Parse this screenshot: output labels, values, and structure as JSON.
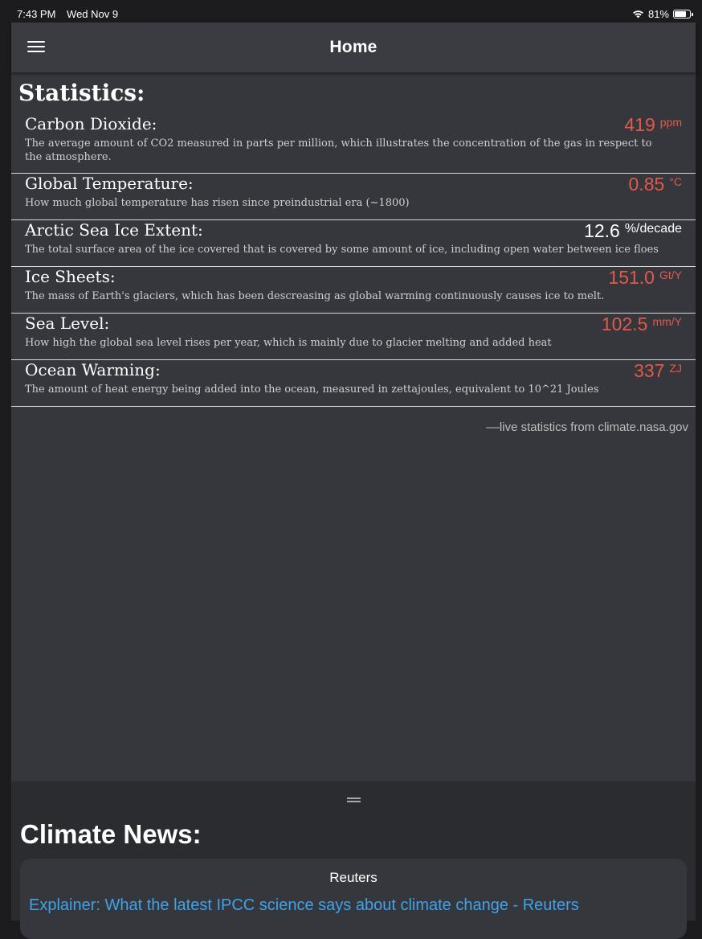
{
  "status_bar": {
    "time": "7:43 PM",
    "date": "Wed Nov 9",
    "battery": "81%",
    "battery_level": 0.81
  },
  "navbar": {
    "title": "Home"
  },
  "statistics": {
    "heading": "Statistics:",
    "items": [
      {
        "name": "Carbon Dioxide:",
        "description": "The average amount of CO2 measured in parts per million, which illustrates the concentration of the gas in respect to the atmosphere.",
        "value": "419",
        "unit": "ppm",
        "color": "#e15a4b"
      },
      {
        "name": "Global Temperature:",
        "description": "How much global temperature has risen since preindustrial era (~1800)",
        "value": "0.85",
        "unit": "°C",
        "color": "#e15a4b"
      },
      {
        "name": "Arctic Sea Ice Extent:",
        "description": "The total surface area of the ice covered that is covered by some amount of ice, including open water between ice floes",
        "value": "12.6",
        "unit": "%/decade",
        "color": "#ffffff"
      },
      {
        "name": "Ice Sheets:",
        "description": "The mass of Earth's glaciers, which has been descreasing as global warming continuously causes ice to melt.",
        "value": "151.0",
        "unit": "Gt/Y",
        "color": "#e15a4b"
      },
      {
        "name": "Sea Level:",
        "description": "How high the global sea level rises per year, which is mainly due to glacier melting and added heat",
        "value": "102.5",
        "unit": "mm/Y",
        "color": "#e15a4b"
      },
      {
        "name": "Ocean Warming:",
        "description": "The amount of heat energy being added into the ocean, measured in zettajoules, equivalent to 10^21 Joules",
        "value": "337",
        "unit": "ZJ",
        "color": "#e15a4b"
      }
    ],
    "source_note": "––live statistics from climate.nasa.gov"
  },
  "news": {
    "heading": "Climate News:",
    "cards": [
      {
        "source": "Reuters",
        "headline": "Explainer: What the latest IPCC science says about climate change - Reuters"
      }
    ]
  }
}
